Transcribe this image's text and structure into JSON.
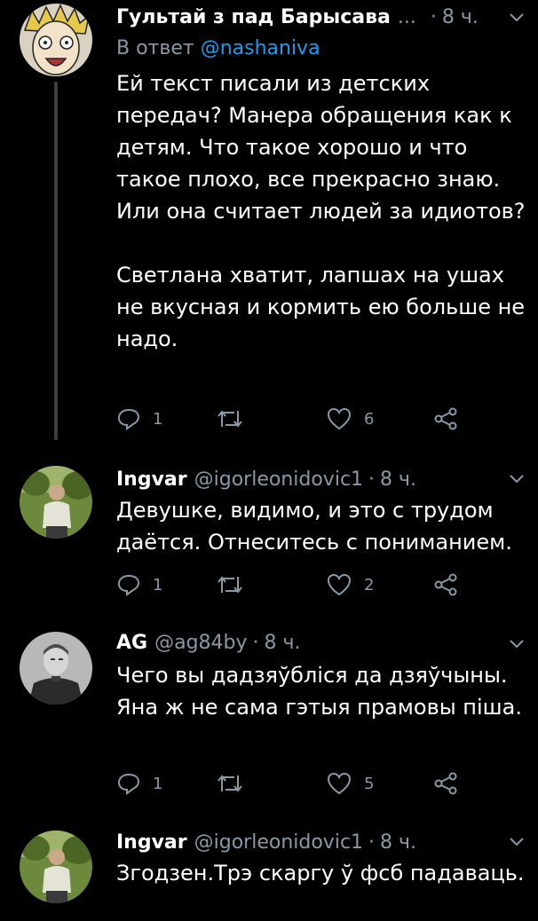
{
  "tweets": [
    {
      "name": "Гультай з пад Барысава",
      "name_suffix": "...",
      "handle": "",
      "time": "8 ч.",
      "reply_to_prefix": "В ответ",
      "reply_to_handle": "@nashaniva",
      "paragraphs": [
        "Ей текст писали из детских передач? Манера обращения как к детям. Что такое хорошо и что такое плохо, все прекрасно знаю. Или она считает людей за идиотов?",
        "Светлана хватит, лапшах на ушах не вкусная и кормить ею больше не надо."
      ],
      "replies": "1",
      "retweets": "",
      "likes": "6"
    },
    {
      "name": "Ingvar",
      "handle": "@igorleonidovic1",
      "time": "8 ч.",
      "paragraphs": [
        "Девушке, видимо, и это с трудом даётся. Отнеситесь с пониманием."
      ],
      "replies": "1",
      "retweets": "",
      "likes": "2"
    },
    {
      "name": "AG",
      "handle": "@ag84by",
      "time": "8 ч.",
      "paragraphs": [
        "Чего вы дадзяўбліся да дзяўчыны. Яна ж не сама гэтыя прамовы піша."
      ],
      "replies": "1",
      "retweets": "",
      "likes": "5"
    },
    {
      "name": "Ingvar",
      "handle": "@igorleonidovic1",
      "time": "8 ч.",
      "paragraphs": [
        "Згодзен.Трэ скаргу ў фсб падаваць."
      ]
    }
  ],
  "colors": {
    "background": "#000000",
    "text": "#ffffff",
    "secondary": "#8899a6",
    "link": "#1d9bf0",
    "thread_line": "#3a3f44"
  },
  "icons": [
    "reply-icon",
    "retweet-icon",
    "like-icon",
    "share-icon",
    "chevron-down-icon"
  ]
}
